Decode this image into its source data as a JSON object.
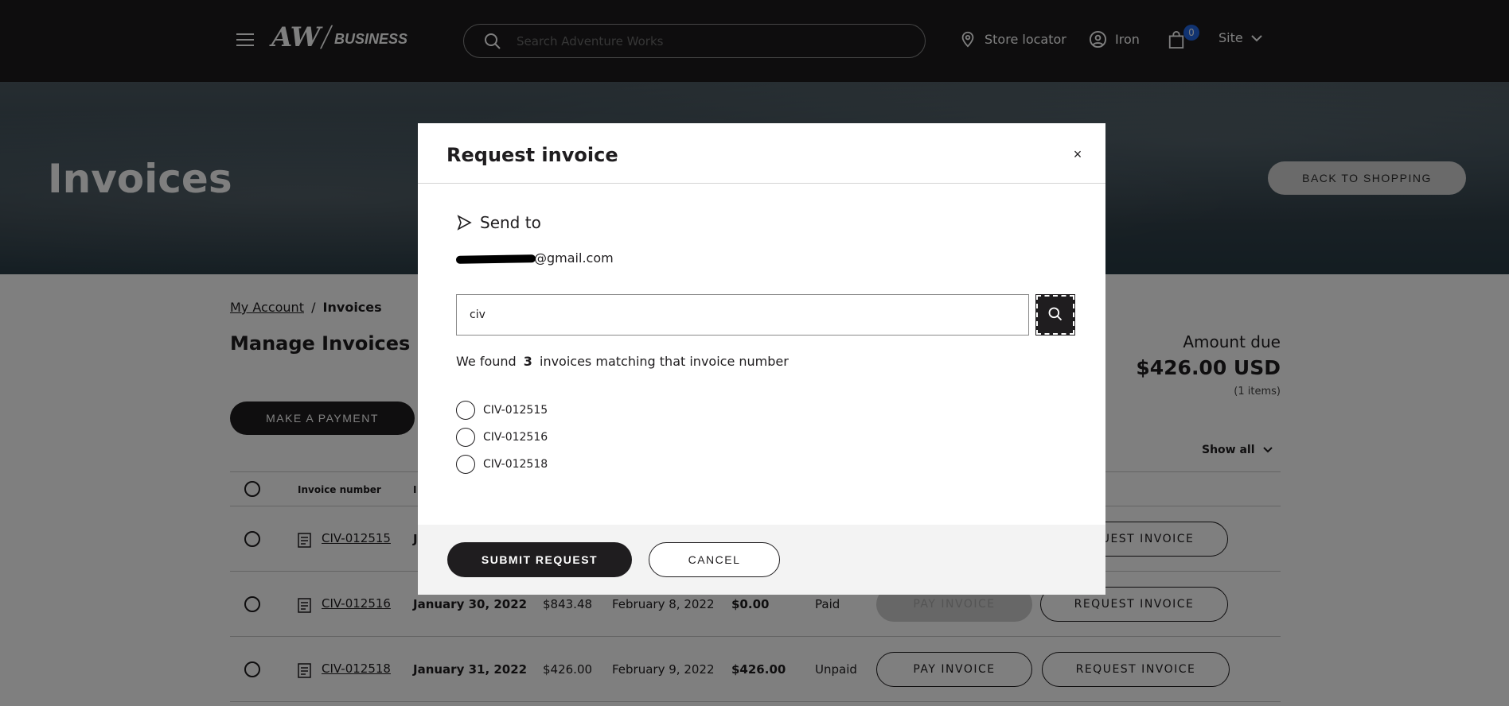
{
  "header": {
    "logo_aw": "AW",
    "logo_business": "BUSINESS",
    "search_placeholder": "Search Adventure Works",
    "store_locator": "Store locator",
    "account": "Iron",
    "cart_count": "0",
    "site": "Site"
  },
  "hero": {
    "title": "Invoices",
    "back_button": "BACK TO SHOPPING"
  },
  "breadcrumb": {
    "parent": "My Account",
    "separator": "/",
    "current": "Invoices"
  },
  "page": {
    "title": "Manage Invoices",
    "make_payment": "MAKE A PAYMENT",
    "amount_label": "Amount due",
    "amount_value": "$426.00 USD",
    "amount_items": "(1 items)",
    "show_all": "Show all"
  },
  "table": {
    "headers": [
      "Invoice number",
      "I"
    ],
    "rows": [
      {
        "invoice": "CIV-012515",
        "date": "J",
        "amount": "",
        "due_date": "",
        "balance": "",
        "status": "",
        "pay_label": "",
        "request_label": "REQUEST INVOICE"
      },
      {
        "invoice": "CIV-012516",
        "date": "January 30, 2022",
        "amount": "$843.48",
        "due_date": "February 8, 2022",
        "balance": "$0.00",
        "status": "Paid",
        "pay_label": "PAY INVOICE",
        "request_label": "REQUEST INVOICE"
      },
      {
        "invoice": "CIV-012518",
        "date": "January 31, 2022",
        "amount": "$426.00",
        "due_date": "February 9, 2022",
        "balance": "$426.00",
        "status": "Unpaid",
        "pay_label": "PAY INVOICE",
        "request_label": "REQUEST INVOICE"
      }
    ]
  },
  "modal": {
    "title": "Request invoice",
    "close": "×",
    "send_to_label": "Send to",
    "email_suffix": "@gmail.com",
    "search_value": "civ",
    "found_prefix": "We found",
    "found_count": "3",
    "found_suffix": "invoices matching that invoice number",
    "options": [
      "CIV-012515",
      "CIV-012516",
      "CIV-012518"
    ],
    "submit": "SUBMIT REQUEST",
    "cancel": "CANCEL"
  },
  "colors": {
    "header_bg": "#1c1b1d",
    "primary": "#1f1d1f",
    "badge": "#2266e3"
  }
}
